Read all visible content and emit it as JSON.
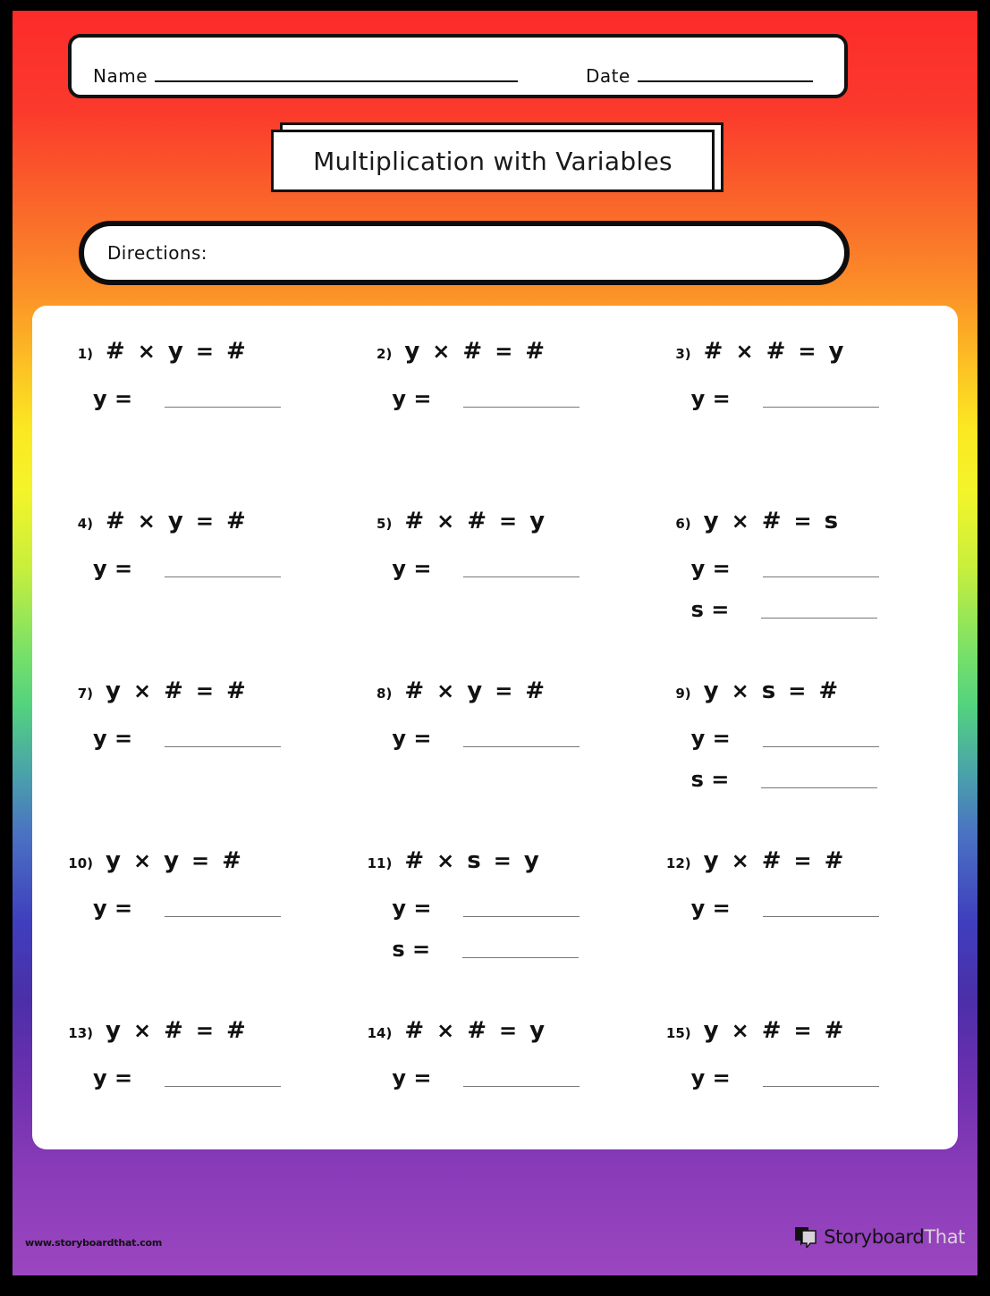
{
  "header": {
    "name_label": "Name",
    "date_label": "Date"
  },
  "title": "Multiplication with Variables",
  "directions_label": "Directions:",
  "problems": [
    {
      "number": "1)",
      "equation": [
        "#",
        "×",
        "y",
        "=",
        "#"
      ],
      "answers": [
        "y ="
      ]
    },
    {
      "number": "2)",
      "equation": [
        "y",
        "×",
        "#",
        "=",
        "#"
      ],
      "answers": [
        "y ="
      ]
    },
    {
      "number": "3)",
      "equation": [
        "#",
        "×",
        "#",
        "=",
        "y"
      ],
      "answers": [
        "y ="
      ]
    },
    {
      "number": "4)",
      "equation": [
        "#",
        "×",
        "y",
        "=",
        "#"
      ],
      "answers": [
        "y ="
      ]
    },
    {
      "number": "5)",
      "equation": [
        "#",
        "×",
        "#",
        "=",
        "y"
      ],
      "answers": [
        "y ="
      ]
    },
    {
      "number": "6)",
      "equation": [
        "y",
        "×",
        "#",
        "=",
        "s"
      ],
      "answers": [
        "y =",
        "s ="
      ]
    },
    {
      "number": "7)",
      "equation": [
        "y",
        "×",
        "#",
        "=",
        "#"
      ],
      "answers": [
        "y ="
      ]
    },
    {
      "number": "8)",
      "equation": [
        "#",
        "×",
        "y",
        "=",
        "#"
      ],
      "answers": [
        "y ="
      ]
    },
    {
      "number": "9)",
      "equation": [
        "y",
        "×",
        "s",
        "=",
        "#"
      ],
      "answers": [
        "y =",
        "s ="
      ]
    },
    {
      "number": "10)",
      "equation": [
        "y",
        "×",
        "y",
        "=",
        "#"
      ],
      "answers": [
        "y ="
      ]
    },
    {
      "number": "11)",
      "equation": [
        "#",
        "×",
        "s",
        "=",
        "y"
      ],
      "answers": [
        "y =",
        "s ="
      ]
    },
    {
      "number": "12)",
      "equation": [
        "y",
        "×",
        "#",
        "=",
        "#"
      ],
      "answers": [
        "y ="
      ]
    },
    {
      "number": "13)",
      "equation": [
        "y",
        "×",
        "#",
        "=",
        "#"
      ],
      "answers": [
        "y ="
      ]
    },
    {
      "number": "14)",
      "equation": [
        "#",
        "×",
        "#",
        "=",
        "y"
      ],
      "answers": [
        "y ="
      ]
    },
    {
      "number": "15)",
      "equation": [
        "y",
        "×",
        "#",
        "=",
        "#"
      ],
      "answers": [
        "y ="
      ]
    }
  ],
  "footer": {
    "url": "www.storyboardthat.com",
    "logo_text_dark": "Storyboard",
    "logo_text_light": "That"
  },
  "colors": {
    "gradient_top": "#fc2b2b",
    "gradient_mid_yellow": "#f4f42a",
    "gradient_mid_green": "#53d27f",
    "gradient_blue": "#3f3fbe",
    "gradient_bottom": "#9b46c0",
    "frame": "#000000",
    "ink": "#111111",
    "rule": "#777777"
  }
}
